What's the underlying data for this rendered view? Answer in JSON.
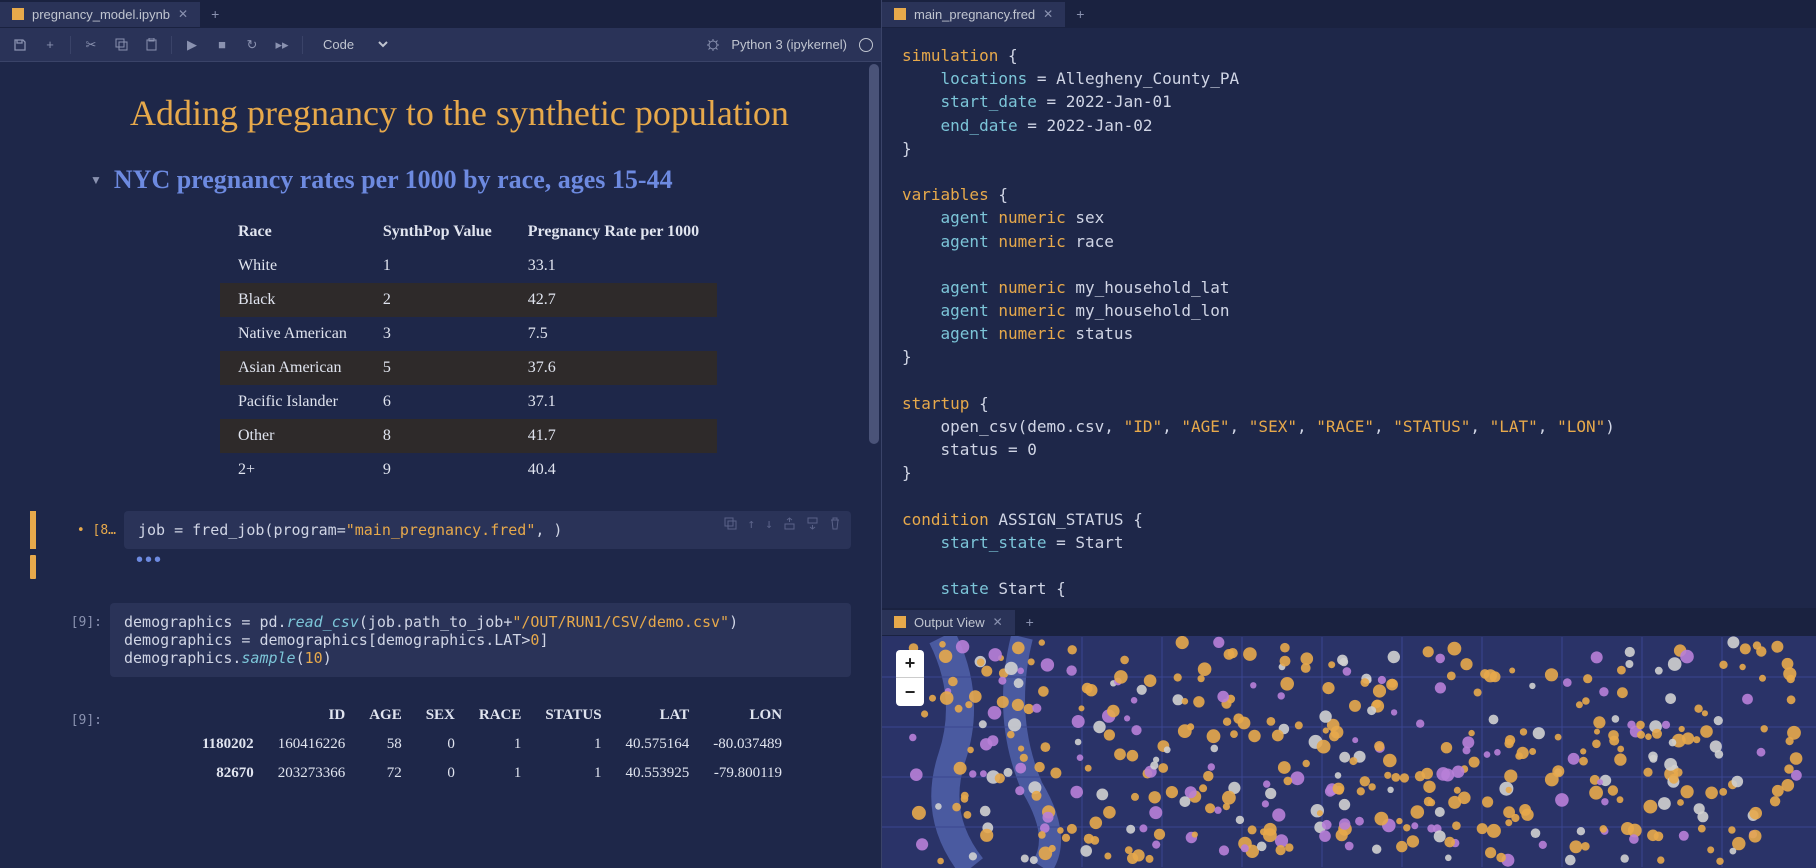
{
  "left_tab": {
    "label": "pregnancy_model.ipynb"
  },
  "toolbar": {
    "cell_type": "Code",
    "kernel": "Python 3 (ipykernel)"
  },
  "nb": {
    "h1": "Adding pregnancy to the synthetic population",
    "h2": "NYC pregnancy rates per 1000 by race, ages 15-44",
    "table": {
      "headers": [
        "Race",
        "SynthPop Value",
        "Pregnancy Rate per 1000"
      ],
      "rows": [
        [
          "White",
          "1",
          "33.1"
        ],
        [
          "Black",
          "2",
          "42.7"
        ],
        [
          "Native American",
          "3",
          "7.5"
        ],
        [
          "Asian American",
          "5",
          "37.6"
        ],
        [
          "Pacific Islander",
          "6",
          "37.1"
        ],
        [
          "Other",
          "8",
          "41.7"
        ],
        [
          "2+",
          "9",
          "40.4"
        ]
      ]
    }
  },
  "cell8": {
    "prompt": "• [8…",
    "code": {
      "p1": "job ",
      "p2": "=",
      "p3": " fred_job(program",
      "p4": "=",
      "p5": "\"main_pregnancy.fred\"",
      "p6": ", )"
    }
  },
  "dots": "•••",
  "cell9a": {
    "prompt": "[9]:",
    "l1": {
      "a": "demographics ",
      "b": "=",
      "c": " pd.",
      "d": "read_csv",
      "e": "(job.path_to_job",
      "f": "+",
      "g": "\"/OUT/RUN1/CSV/demo.csv\"",
      "h": ")"
    },
    "l2": {
      "a": "demographics ",
      "b": "=",
      "c": " demographics[demographics.LAT",
      "d": ">",
      "e": "0",
      "f": "]"
    },
    "l3": {
      "a": "demographics.",
      "b": "sample",
      "c": "(",
      "d": "10",
      "e": ")"
    }
  },
  "cell9b": {
    "prompt": "[9]:",
    "headers": [
      "",
      "ID",
      "AGE",
      "SEX",
      "RACE",
      "STATUS",
      "LAT",
      "LON"
    ],
    "rows": [
      [
        "1180202",
        "160416226",
        "58",
        "0",
        "1",
        "1",
        "40.575164",
        "-80.037489"
      ],
      [
        "82670",
        "203273366",
        "72",
        "0",
        "1",
        "1",
        "40.553925",
        "-79.800119"
      ]
    ]
  },
  "right_tab": {
    "label": "main_pregnancy.fred"
  },
  "code": {
    "l1a": "simulation",
    "l1b": " {",
    "l2a": "    locations ",
    "l2b": "=",
    "l2c": " Allegheny_County_PA",
    "l3a": "    start_date ",
    "l3b": "=",
    "l3c": " 2022-Jan-01",
    "l4a": "    end_date ",
    "l4b": "=",
    "l4c": " 2022-Jan-02",
    "l5": "}",
    "l7a": "variables",
    "l7b": " {",
    "l8a": "    agent ",
    "l8b": "numeric",
    "l8c": " sex",
    "l9a": "    agent ",
    "l9b": "numeric",
    "l9c": " race",
    "l11a": "    agent ",
    "l11b": "numeric",
    "l11c": " my_household_lat",
    "l12a": "    agent ",
    "l12b": "numeric",
    "l12c": " my_household_lon",
    "l13a": "    agent ",
    "l13b": "numeric",
    "l13c": " status",
    "l14": "}",
    "l16a": "startup",
    "l16b": " {",
    "l17a": "    open_csv(demo.csv, ",
    "l17b": "\"ID\"",
    "l17c": ", ",
    "l17d": "\"AGE\"",
    "l17e": ", ",
    "l17f": "\"SEX\"",
    "l17g": ", ",
    "l17h": "\"RACE\"",
    "l17i": ", ",
    "l17j": "\"STATUS\"",
    "l17k": ", ",
    "l17l": "\"LAT\"",
    "l17m": ", ",
    "l17n": "\"LON\"",
    "l17o": ")",
    "l18a": "    status ",
    "l18b": "=",
    "l18c": " 0",
    "l19": "}",
    "l21a": "condition",
    "l21b": " ASSIGN_STATUS {",
    "l22a": "    start_state ",
    "l22b": "=",
    "l22c": " Start",
    "l24a": "    state",
    "l24b": " Start {"
  },
  "output_tab": {
    "label": "Output View"
  },
  "map": {
    "zoom_in": "+",
    "zoom_out": "−"
  }
}
